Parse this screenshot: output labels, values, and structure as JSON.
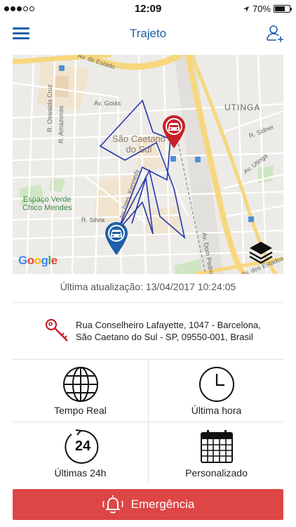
{
  "status_bar": {
    "time": "12:09",
    "battery": "70%",
    "battery_level": 0.7,
    "signal_bars_filled": 3,
    "signal_bars_total": 5
  },
  "navbar": {
    "title": "Trajeto",
    "menu_icon": "hamburger-menu-icon",
    "action_icon": "user-add-icon"
  },
  "map": {
    "labels": {
      "av_do_estado_top": "Av. do Estado",
      "av_goias": "Av. Goiás",
      "r_oswaldo_cruz": "R. Oswaldo Cruz",
      "r_amazonas": "R. Amazonas",
      "city": "São Caetano\ndo Sul",
      "district": "UTINGA",
      "r_sidnei": "R. Sidnei",
      "av_utinga": "Av. Utinga",
      "av_pres_kennedy": "Av. Pres. Kennedy",
      "park": "Espaço Verde\nChico Mendes",
      "r_silvia": "R. Silvia",
      "av_dom_pedro": "Av. Dom Pedro II",
      "av_estados": "Av. dos Estados",
      "google": "Google"
    },
    "pins": {
      "end": {
        "label": "car-end-pin",
        "color": "#c8202a"
      },
      "start": {
        "label": "car-start-pin",
        "color": "#1f5fa8"
      }
    },
    "route_color": "#2436a8"
  },
  "last_update": "Última atualização: 13/04/2017 10:24:05",
  "address": {
    "line1": "Rua Conselheiro Lafayette, 1047 - Barcelona,",
    "line2": "São Caetano do Sul - SP, 09550-001, Brasil",
    "icon_color": "#c8202a"
  },
  "options": [
    {
      "label": "Tempo Real",
      "icon": "globe-icon"
    },
    {
      "label": "Última hora",
      "icon": "clock-icon"
    },
    {
      "label": "Últimas 24h",
      "icon": "24h-history-icon",
      "icon_text": "24"
    },
    {
      "label": "Personalizado",
      "icon": "calendar-icon"
    }
  ],
  "emergency": {
    "label": "Emergência",
    "color": "#de4546"
  }
}
